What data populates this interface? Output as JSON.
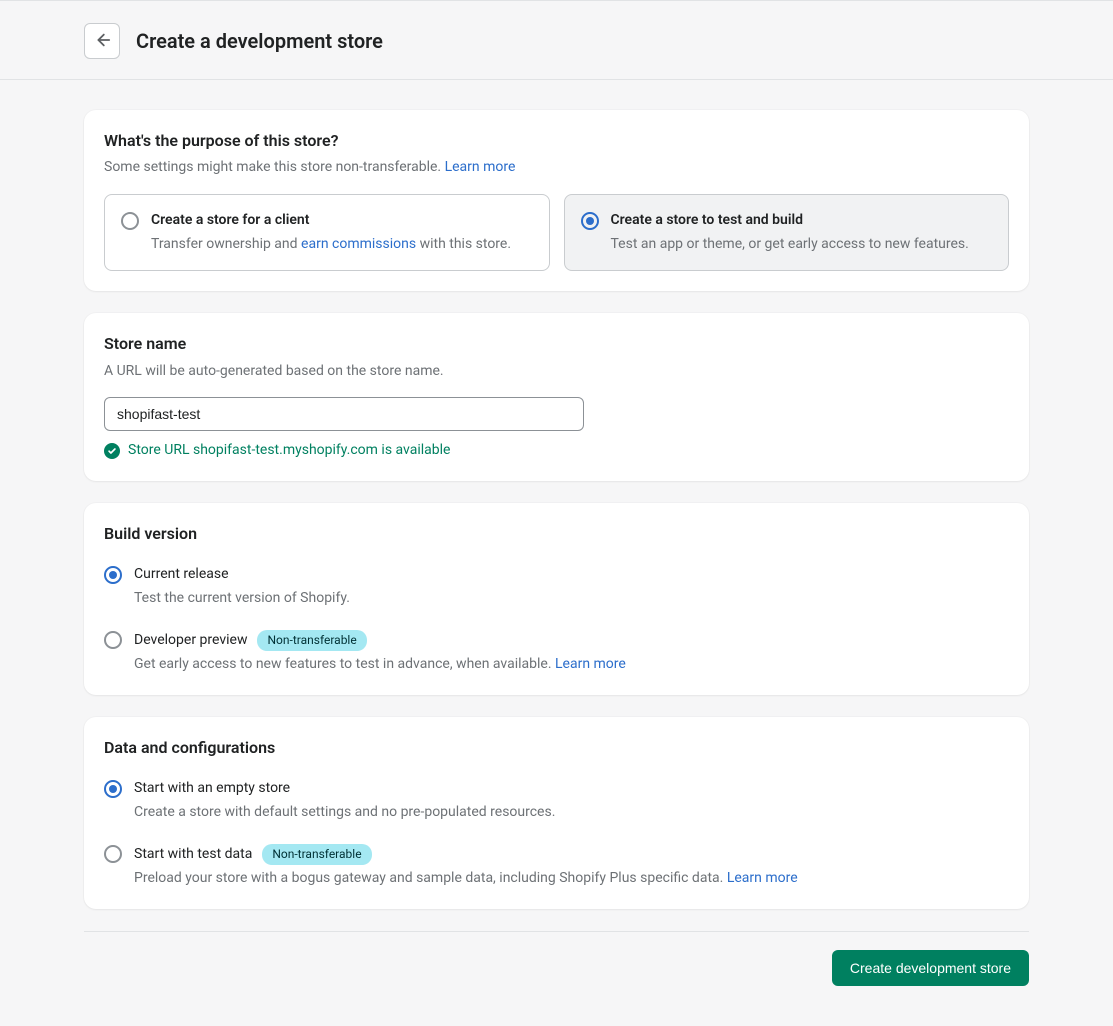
{
  "header": {
    "title": "Create a development store"
  },
  "purpose": {
    "heading": "What's the purpose of this store?",
    "sub_prefix": "Some settings might make this store non-transferable. ",
    "learn_more": "Learn more",
    "options": [
      {
        "title": "Create a store for a client",
        "desc_pre": "Transfer ownership and ",
        "desc_link": "earn commissions",
        "desc_post": " with this store.",
        "selected": false
      },
      {
        "title": "Create a store to test and build",
        "desc": "Test an app or theme, or get early access to new features.",
        "selected": true
      }
    ]
  },
  "store_name": {
    "heading": "Store name",
    "sub": "A URL will be auto-generated based on the store name.",
    "value": "shopifast-test",
    "availability": "Store URL shopifast-test.myshopify.com is available"
  },
  "build_version": {
    "heading": "Build version",
    "options": [
      {
        "title": "Current release",
        "desc": "Test the current version of Shopify.",
        "selected": true,
        "badge": null,
        "learn_more": null
      },
      {
        "title": "Developer preview",
        "desc_pre": "Get early access to new features to test in advance, when available. ",
        "badge": "Non-transferable",
        "learn_more": "Learn more",
        "selected": false
      }
    ]
  },
  "data_config": {
    "heading": "Data and configurations",
    "options": [
      {
        "title": "Start with an empty store",
        "desc": "Create a store with default settings and no pre-populated resources.",
        "selected": true,
        "badge": null,
        "learn_more": null
      },
      {
        "title": "Start with test data",
        "desc_pre": "Preload your store with a bogus gateway and sample data, including Shopify Plus specific data. ",
        "badge": "Non-transferable",
        "learn_more": "Learn more",
        "selected": false
      }
    ]
  },
  "footer": {
    "submit": "Create development store"
  }
}
